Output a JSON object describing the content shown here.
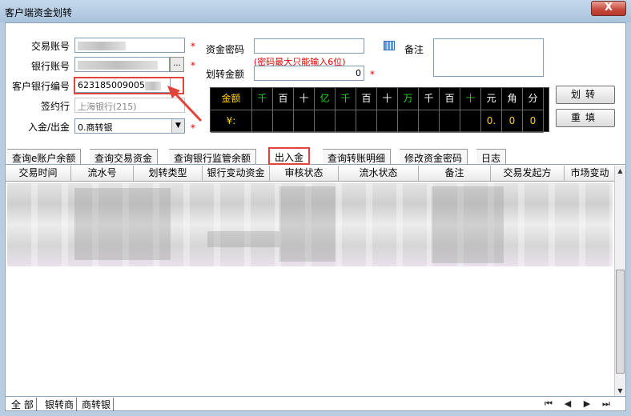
{
  "window": {
    "title": "客户端资金划转",
    "close_label": "X"
  },
  "form": {
    "trade_account_label": "交易账号",
    "bank_account_label": "银行账号",
    "bank_customer_no_label": "客户银行编号",
    "bank_customer_no_value": "623185009005",
    "sign_bank_label": "签约行",
    "sign_bank_value": "上海银行(215)",
    "direction_label": "入金/出金",
    "direction_value": "0.商转银",
    "fund_password_label": "资金密码",
    "transfer_amount_label": "划转金额",
    "password_hint": "(密码最大只能输入6位)",
    "transfer_amount_value": "0",
    "remark_label": "备注",
    "required_mark": "*"
  },
  "amount_grid": {
    "row1": [
      {
        "t": "金额",
        "c": "y"
      },
      {
        "t": "千",
        "c": "g"
      },
      {
        "t": "百",
        "c": "w"
      },
      {
        "t": "十",
        "c": "w"
      },
      {
        "t": "亿",
        "c": "g"
      },
      {
        "t": "千",
        "c": "g"
      },
      {
        "t": "百",
        "c": "w"
      },
      {
        "t": "十",
        "c": "w"
      },
      {
        "t": "万",
        "c": "g"
      },
      {
        "t": "千",
        "c": "w"
      },
      {
        "t": "百",
        "c": "w"
      },
      {
        "t": "十",
        "c": "g"
      },
      {
        "t": "元",
        "c": "w"
      },
      {
        "t": "角",
        "c": "w"
      },
      {
        "t": "分",
        "c": "w"
      }
    ],
    "row2": [
      {
        "t": "¥:",
        "c": "y"
      },
      {
        "t": "",
        "c": "w"
      },
      {
        "t": "",
        "c": "w"
      },
      {
        "t": "",
        "c": "w"
      },
      {
        "t": "",
        "c": "w"
      },
      {
        "t": "",
        "c": "w"
      },
      {
        "t": "",
        "c": "w"
      },
      {
        "t": "",
        "c": "w"
      },
      {
        "t": "",
        "c": "w"
      },
      {
        "t": "",
        "c": "w"
      },
      {
        "t": "",
        "c": "w"
      },
      {
        "t": "",
        "c": "w"
      },
      {
        "t": "0.",
        "c": "y"
      },
      {
        "t": "0",
        "c": "y"
      },
      {
        "t": "0",
        "c": "y"
      }
    ]
  },
  "buttons": {
    "transfer": "划转",
    "reset": "重填"
  },
  "tabs": [
    {
      "label": "查询e账户余额"
    },
    {
      "label": "查询交易资金"
    },
    {
      "label": "查询银行监管余额"
    },
    {
      "label": "出入金"
    },
    {
      "label": "查询转账明细"
    },
    {
      "label": "修改资金密码"
    },
    {
      "label": "日志"
    }
  ],
  "columns": [
    "交易时间",
    "流水号",
    "划转类型",
    "银行变动资金",
    "审核状态",
    "流水状态",
    "备注",
    "交易发起方",
    "市场变动"
  ],
  "bottom_tabs": [
    "全 部",
    "银转商",
    "商转银"
  ],
  "nav": {
    "first": "first-page",
    "prev": "prev-page",
    "next": "next-page",
    "last": "last-page"
  }
}
